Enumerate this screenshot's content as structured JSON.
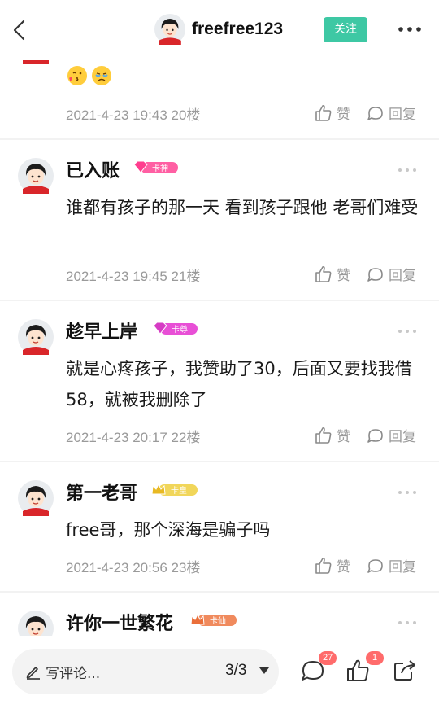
{
  "header": {
    "username": "freefree123",
    "follow_label": "关注"
  },
  "comments": [
    {
      "meta": "2021-4-23 19:43  20楼",
      "like_label": "赞",
      "reply_label": "回复"
    },
    {
      "username": "已入账",
      "badge": "卡神",
      "text": "谁都有孩子的那一天  看到孩子跟他  老哥们难受",
      "meta": "2021-4-23 19:45  21楼",
      "like_label": "赞",
      "reply_label": "回复"
    },
    {
      "username": "趁早上岸",
      "badge": "卡尊",
      "text": "就是心疼孩子，我赞助了30，后面又要找我借58，就被我删除了",
      "meta": "2021-4-23 20:17  22楼",
      "like_label": "赞",
      "reply_label": "回复"
    },
    {
      "username": "第一老哥",
      "badge": "卡皇",
      "text": "free哥，那个深海是骗子吗",
      "meta": "2021-4-23 20:56  23楼",
      "like_label": "赞",
      "reply_label": "回复"
    },
    {
      "username": "许你一世繁花",
      "badge": "卡仙"
    }
  ],
  "bottom_bar": {
    "write_placeholder": "写评论...",
    "page_indicator": "3/3",
    "comment_count": "27",
    "like_count": "1"
  },
  "colors": {
    "accent": "#3ec8a4",
    "badge_red": "#ff6b6b",
    "badge_pink": "#ff4fa0",
    "badge_gold": "#e8c94a",
    "badge_orange": "#f08a5d"
  }
}
